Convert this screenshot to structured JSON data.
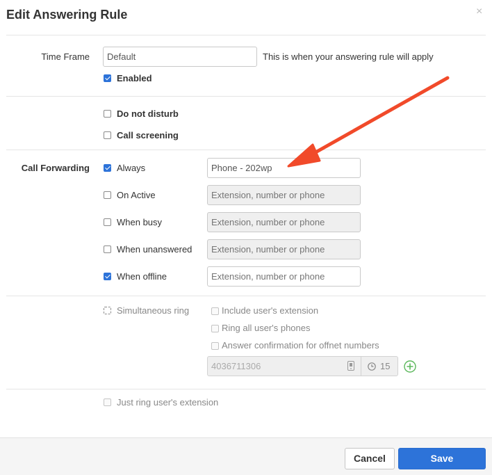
{
  "dialog": {
    "title": "Edit Answering Rule",
    "close_glyph": "×"
  },
  "time_frame": {
    "label": "Time Frame",
    "value": "Default",
    "hint": "This is when your answering rule will apply",
    "enabled_label": "Enabled",
    "enabled_checked": true
  },
  "options": {
    "do_not_disturb": {
      "label": "Do not disturb",
      "checked": false
    },
    "call_screening": {
      "label": "Call screening",
      "checked": false
    }
  },
  "call_forwarding": {
    "label": "Call Forwarding",
    "rows": [
      {
        "label": "Always",
        "checked": true,
        "value": "Phone - 202wp",
        "placeholder": "",
        "disabled": false
      },
      {
        "label": "On Active",
        "checked": false,
        "value": "",
        "placeholder": "Extension, number or phone",
        "disabled": true
      },
      {
        "label": "When busy",
        "checked": false,
        "value": "",
        "placeholder": "Extension, number or phone",
        "disabled": true
      },
      {
        "label": "When unanswered",
        "checked": false,
        "value": "",
        "placeholder": "Extension, number or phone",
        "disabled": true
      },
      {
        "label": "When offline",
        "checked": true,
        "value": "",
        "placeholder": "Extension, number or phone",
        "disabled": false
      }
    ]
  },
  "simultaneous": {
    "label": "Simultaneous ring",
    "checked": false,
    "include_ext": "Include user's extension",
    "ring_all": "Ring all user's phones",
    "answer_confirm": "Answer confirmation for offnet numbers",
    "number": "4036711306",
    "timeout": "15",
    "icons": {
      "phone": "phone-icon",
      "clock": "clock-icon",
      "add": "add-circle-icon"
    }
  },
  "just_ring": {
    "label": "Just ring user's extension",
    "checked": false
  },
  "footer": {
    "cancel": "Cancel",
    "save": "Save"
  },
  "colors": {
    "primary": "#2d73d9",
    "arrow": "#f14a2a",
    "add": "#4caf50"
  }
}
